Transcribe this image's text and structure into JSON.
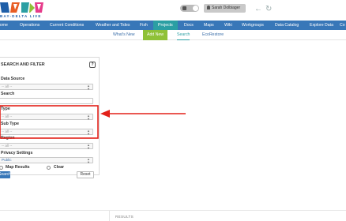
{
  "header": {
    "logo_tagline": "BAY-DELTA LIVE",
    "user_label": "Sarah Dolbiager",
    "back_icon": "arrow-left-icon",
    "refresh_icon": "refresh-icon"
  },
  "nav": {
    "items": [
      {
        "label": "Home"
      },
      {
        "label": "Operations"
      },
      {
        "label": "Current Conditions"
      },
      {
        "label": "Weather and Tides"
      },
      {
        "label": "Fish"
      },
      {
        "label": "Projects",
        "active": true
      },
      {
        "label": "Docs"
      },
      {
        "label": "Maps"
      },
      {
        "label": "Wiki"
      },
      {
        "label": "Workgroups"
      },
      {
        "label": "Data Catalog"
      },
      {
        "label": "Explore Data"
      },
      {
        "label": "Co"
      }
    ]
  },
  "subnav": {
    "whats_new": "What's New",
    "add_new": "Add New",
    "search": "Search",
    "ecorestore": "EcoRestore"
  },
  "panel": {
    "title": "SEARCH AND FILTER",
    "help": "?",
    "data_source_label": "Data Source",
    "data_source_value": "-- all --",
    "search_label": "Search",
    "type_label": "Type",
    "type_value": "-- all --",
    "sub_type_label": "Sub Type",
    "sub_type_value": "-- all --",
    "region_label": "Region",
    "region_value": "-- all --",
    "privacy_label": "Privacy Settings",
    "privacy_value": "Public",
    "map_results_label": "Map Results",
    "clear_label": "Clear",
    "search_button": "Search",
    "reset_button": "Reset"
  },
  "results": {
    "label": "RESULTS"
  },
  "colors": {
    "nav_blue": "#3877b8",
    "active_teal": "#2b9fa3",
    "add_green": "#8fc137",
    "annotation_red": "#e32119"
  }
}
